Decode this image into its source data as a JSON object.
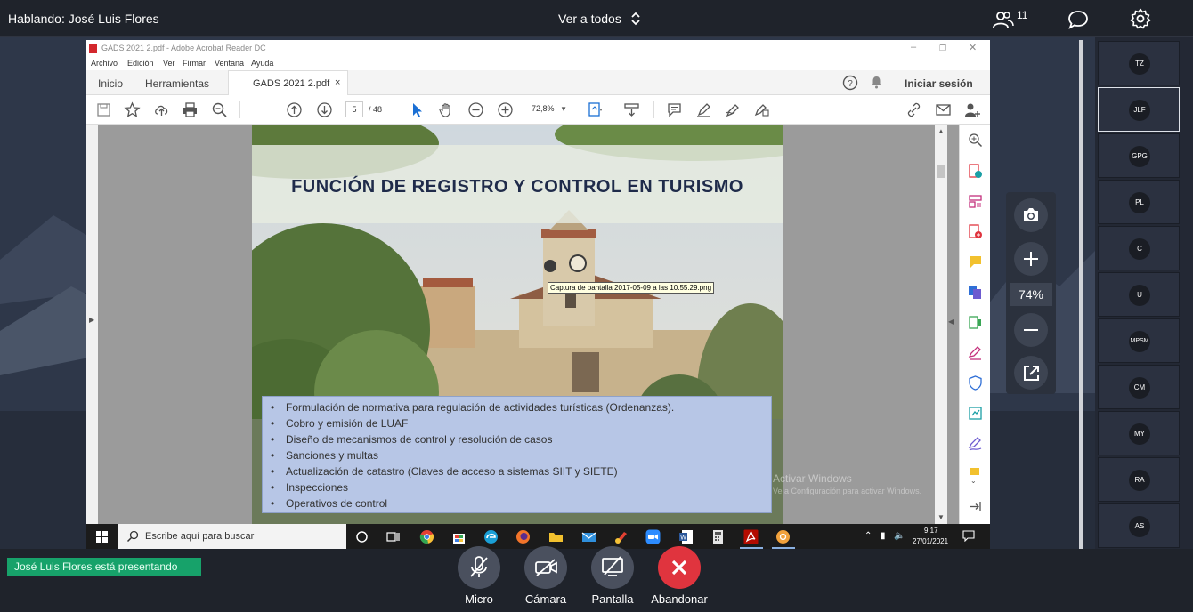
{
  "topbar": {
    "speaking": "Hablando: José Luis Flores",
    "view_all": "Ver a todos",
    "participants_count": "11"
  },
  "acrobat": {
    "window_title": "GADS 2021 2.pdf - Adobe Acrobat Reader DC",
    "menu": [
      "Archivo",
      "Edición",
      "Ver",
      "Firmar",
      "Ventana",
      "Ayuda"
    ],
    "tabs": {
      "home": "Inicio",
      "tools": "Herramientas",
      "document": "GADS 2021 2.pdf",
      "close": "×"
    },
    "sign_in": "Iniciar sesión",
    "page_current": "5",
    "page_total": "/ 48",
    "zoom": "72,8%"
  },
  "slide": {
    "title": "FUNCIÓN DE REGISTRO Y CONTROL EN TURISMO",
    "bullets": [
      "Formulación de normativa para regulación de actividades turísticas (Ordenanzas).",
      "Cobro y emisión de LUAF",
      "Diseño de mecanismos de control y resolución de casos",
      "Sanciones y multas",
      "Actualización de catastro (Claves de acceso a sistemas SIIT y SIETE)",
      "Inspecciones",
      "Operativos de control"
    ],
    "tooltip": "Captura de pantalla 2017-05-09 a las 10.55.29.png"
  },
  "windows_watermark": {
    "line1": "Activar Windows",
    "line2": "Ve a Configuración para activar Windows."
  },
  "taskbar": {
    "search_placeholder": "Escribe aquí para buscar",
    "time": "9:17",
    "date": "27/01/2021"
  },
  "zoom_controls": {
    "percent": "74%"
  },
  "participants": [
    "TZ",
    "JLF",
    "GPG",
    "PL",
    "C",
    "U",
    "MPSM",
    "CM",
    "MY",
    "RA",
    "AS"
  ],
  "bottombar": {
    "presenting": "José Luis Flores está presentando",
    "controls": {
      "mic": "Micro",
      "camera": "Cámara",
      "screen": "Pantalla",
      "leave": "Abandonar"
    }
  },
  "colors": {
    "leave_red": "#e0343e",
    "presenting_green": "#17a26a",
    "bullet_box": "#b7c6e6",
    "slide_title": "#1f2b4a"
  }
}
